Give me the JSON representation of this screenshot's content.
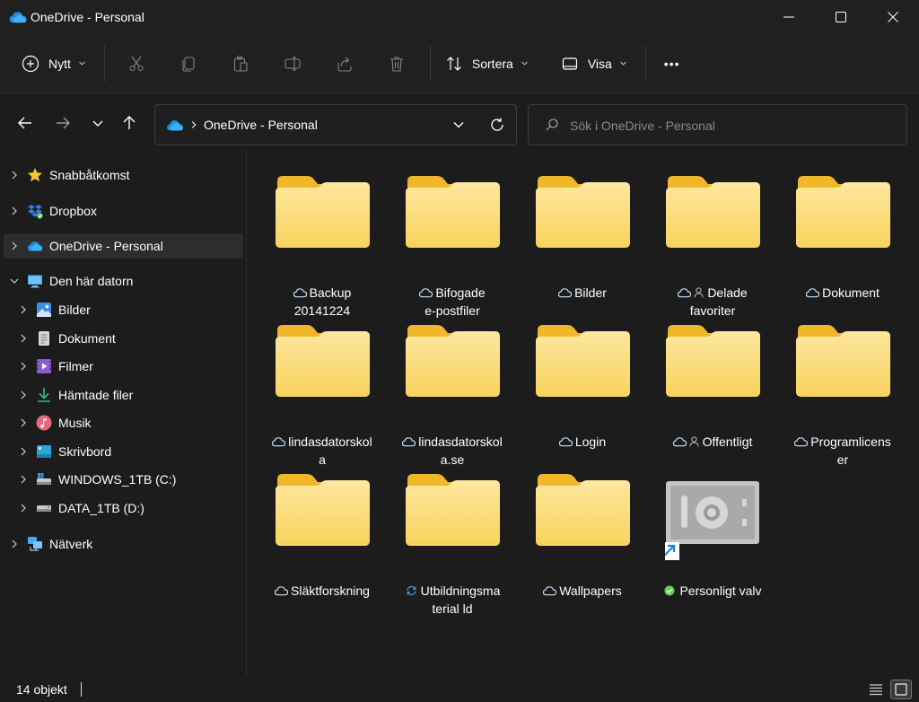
{
  "window": {
    "title": "OneDrive - Personal"
  },
  "command_bar": {
    "new_label": "Nytt",
    "sort_label": "Sortera",
    "view_label": "Visa",
    "more_label": "•••"
  },
  "address_bar": {
    "path": "OneDrive - Personal",
    "search_placeholder": "Sök i OneDrive - Personal"
  },
  "sidebar": {
    "items": [
      {
        "label": "Snabbåtkomst"
      },
      {
        "label": "Dropbox"
      },
      {
        "label": "OneDrive - Personal"
      },
      {
        "label": "Den här datorn"
      },
      {
        "label": "Bilder"
      },
      {
        "label": "Dokument"
      },
      {
        "label": "Filmer"
      },
      {
        "label": "Hämtade filer"
      },
      {
        "label": "Musik"
      },
      {
        "label": "Skrivbord"
      },
      {
        "label": "WINDOWS_1TB (C:)"
      },
      {
        "label": "DATA_1TB (D:)"
      },
      {
        "label": "Nätverk"
      }
    ]
  },
  "files": [
    {
      "line1": "Backup",
      "line2": "20141224",
      "status": "cloud",
      "shared": false
    },
    {
      "line1": "Bifogade",
      "line2": "e-postfiler",
      "status": "cloud",
      "shared": false
    },
    {
      "line1": "Bilder",
      "line2": "",
      "status": "cloud",
      "shared": false
    },
    {
      "line1": "Delade",
      "line2": "favoriter",
      "status": "cloud",
      "shared": true
    },
    {
      "line1": "Dokument",
      "line2": "",
      "status": "cloud",
      "shared": false
    },
    {
      "line1": "lindasdatorskol",
      "line2": "a",
      "status": "cloud",
      "shared": false
    },
    {
      "line1": "lindasdatorskol",
      "line2": "a.se",
      "status": "cloud",
      "shared": false
    },
    {
      "line1": "Login",
      "line2": "",
      "status": "cloud",
      "shared": false
    },
    {
      "line1": "Offentligt",
      "line2": "",
      "status": "cloud",
      "shared": true
    },
    {
      "line1": "Programlicens",
      "line2": "er",
      "status": "cloud",
      "shared": false
    },
    {
      "line1": "Släktforskning",
      "line2": "",
      "status": "cloud",
      "shared": false
    },
    {
      "line1": "Utbildningsma",
      "line2": "terial ld",
      "status": "syncing",
      "shared": false
    },
    {
      "line1": "Wallpapers",
      "line2": "",
      "status": "cloud",
      "shared": false
    },
    {
      "line1": "Personligt valv",
      "line2": "",
      "status": "available",
      "shared": false
    }
  ],
  "status_bar": {
    "item_count": "14 objekt"
  },
  "colors": {
    "accent": "#4cc2ff",
    "folder_light": "#fbe18d",
    "folder_dark": "#f5c02b",
    "cloud_blue": "#c8e6ff",
    "sync_blue": "#3b9af0",
    "available_green": "#6ccb5f"
  }
}
